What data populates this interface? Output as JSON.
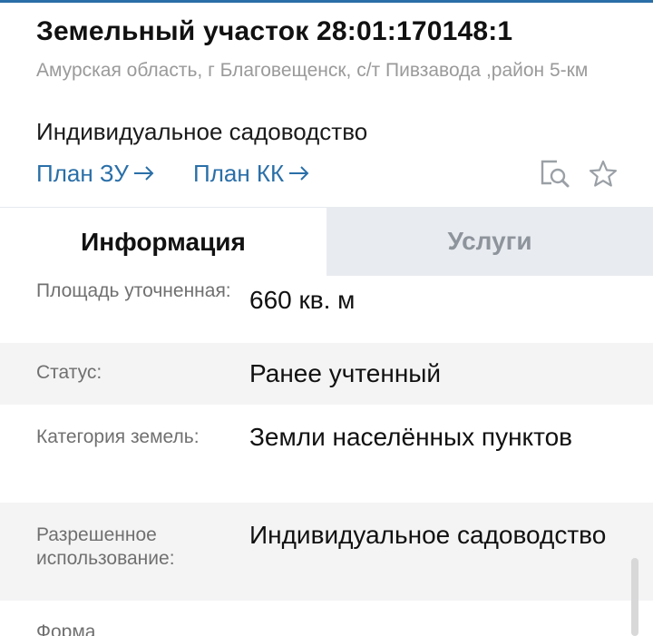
{
  "header": {
    "title": "Земельный участок 28:01:170148:1",
    "address": "Амурская область, г Благовещенск, с/т Пивзавода ,район 5-км",
    "purpose": "Индивидуальное садоводство",
    "links": [
      {
        "label": "План ЗУ"
      },
      {
        "label": "План КК"
      }
    ],
    "icons": [
      "map-search-icon",
      "star-icon"
    ]
  },
  "tabs": [
    {
      "label": "Информация",
      "active": true
    },
    {
      "label": "Услуги",
      "active": false
    }
  ],
  "info": [
    {
      "key": "Площадь уточненная:",
      "value": "660 кв. м"
    },
    {
      "key": "Статус:",
      "value": "Ранее учтенный"
    },
    {
      "key": "Категория земель:",
      "value": "Земли населённых пунктов"
    },
    {
      "key": "Разрешенное использование:",
      "value": "Индивидуальное садоводство"
    },
    {
      "key": "Форма",
      "value": ""
    }
  ],
  "colors": {
    "accent": "#2a6fa8",
    "tab_inactive_bg": "#e8ebf0",
    "row_shade": "#f4f4f5",
    "muted": "#9a9a9a"
  }
}
